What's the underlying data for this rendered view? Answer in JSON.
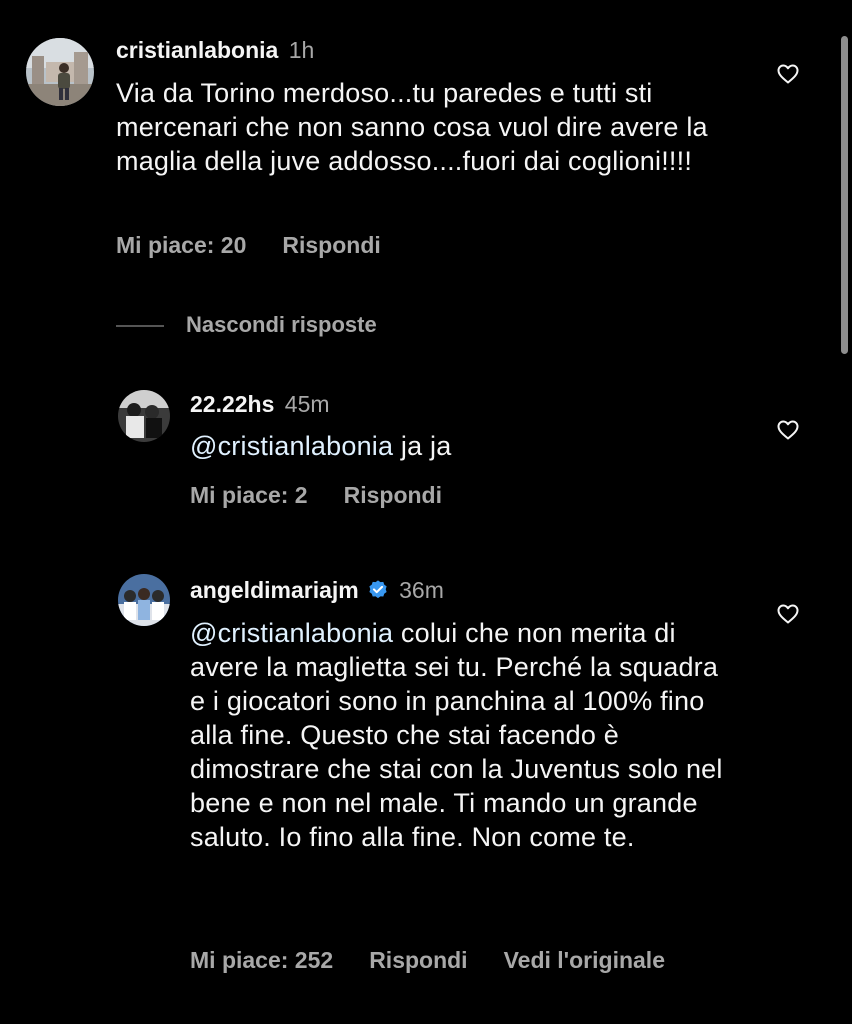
{
  "comments": [
    {
      "username": "cristianlabonia",
      "time": "1h",
      "text": "Via da Torino merdoso...tu paredes e tutti sti mercenari che non sanno cosa vuol dire avere la maglia della juve addosso....fuori dai coglioni!!!!",
      "likes": "Mi piace: 20",
      "reply": "Rispondi"
    }
  ],
  "hide_replies": "Nascondi risposte",
  "replies": [
    {
      "username": "22.22hs",
      "time": "45m",
      "mention": "@cristianlabonia",
      "text": " ja ja",
      "likes": "Mi piace: 2",
      "reply": "Rispondi"
    },
    {
      "username": "angeldimariajm",
      "time": "36m",
      "verified": true,
      "mention": "@cristianlabonia",
      "text": " colui che non merita di avere la maglietta sei tu. Perché la squadra e i giocatori sono in panchina al 100% fino alla fine. Questo che stai facendo è dimostrare che stai con la Juventus solo nel bene e non nel male. Ti mando un grande saluto. Io fino alla fine. Non come te.",
      "likes": "Mi piace: 252",
      "reply": "Rispondi",
      "translate": "Vedi l'originale"
    }
  ],
  "icons": {
    "like": "heart-outline-icon",
    "verified": "verified-badge-icon"
  },
  "colors": {
    "background": "#000000",
    "text": "#f5f5f5",
    "secondary": "#a8a8a8",
    "mention": "#e0f1ff",
    "verified": "#3897f0"
  }
}
